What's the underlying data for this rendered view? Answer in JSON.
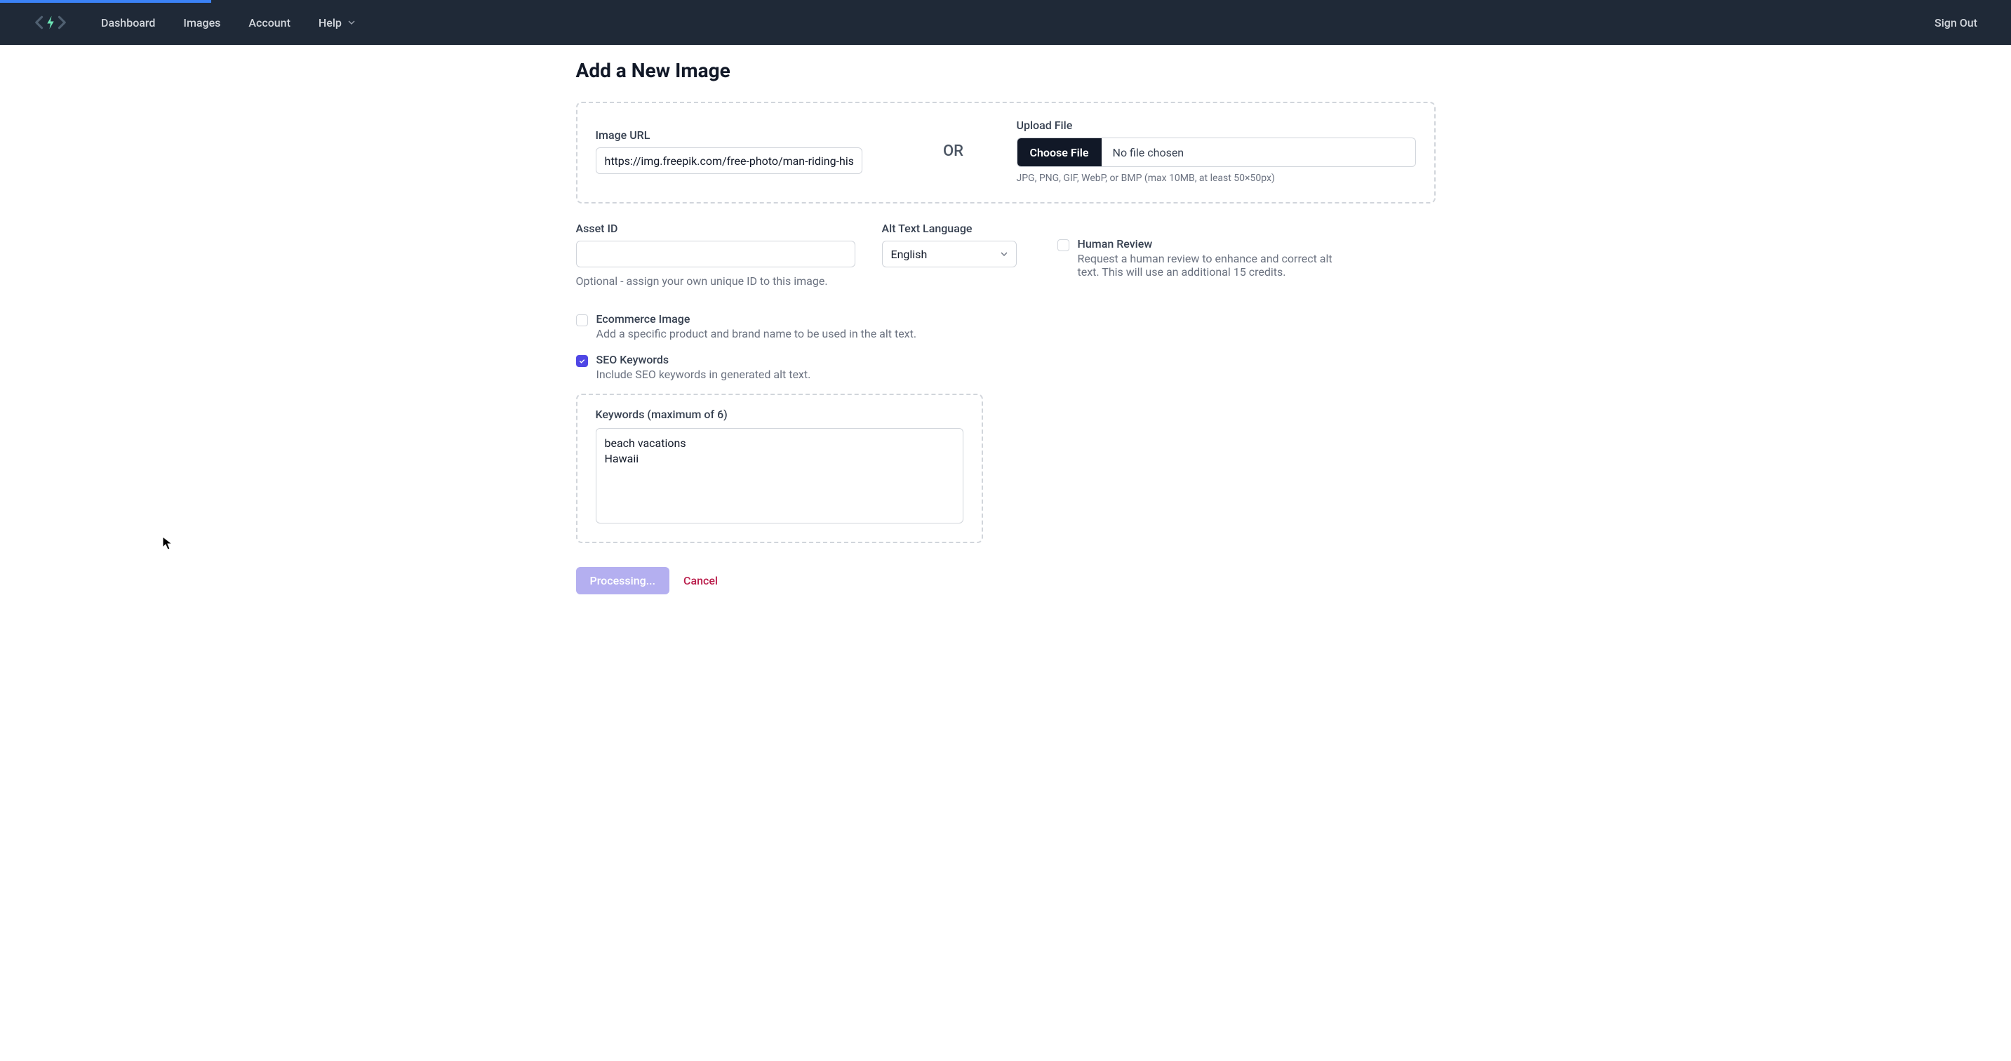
{
  "nav": {
    "dashboard": "Dashboard",
    "images": "Images",
    "account": "Account",
    "help": "Help",
    "sign_out": "Sign Out"
  },
  "page_title": "Add a New Image",
  "upload": {
    "url_label": "Image URL",
    "url_value": "https://img.freepik.com/free-photo/man-riding-his-su",
    "or": "OR",
    "file_label": "Upload File",
    "choose_button": "Choose File",
    "no_file": "No file chosen",
    "file_hint": "JPG, PNG, GIF, WebP, or BMP (max 10MB, at least 50×50px)"
  },
  "asset": {
    "label": "Asset ID",
    "value": "",
    "hint": "Optional - assign your own unique ID to this image."
  },
  "lang": {
    "label": "Alt Text Language",
    "value": "English"
  },
  "review": {
    "label": "Human Review",
    "desc": "Request a human review to enhance and correct alt text. This will use an additional 15 credits."
  },
  "ecommerce": {
    "label": "Ecommerce Image",
    "desc": "Add a specific product and brand name to be used in the alt text."
  },
  "seo": {
    "label": "SEO Keywords",
    "desc": "Include SEO keywords in generated alt text."
  },
  "keywords": {
    "label": "Keywords (maximum of 6)",
    "value": "beach vacations\nHawaii"
  },
  "actions": {
    "submit": "Processing...",
    "cancel": "Cancel"
  }
}
